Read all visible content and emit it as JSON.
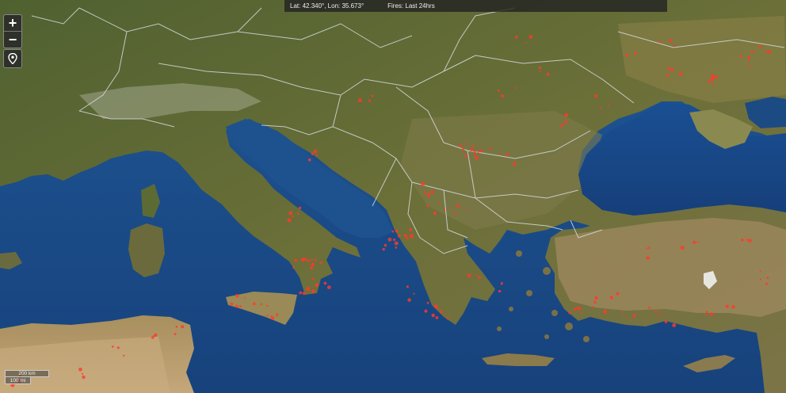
{
  "status": {
    "coords": "Lat: 42.340°, Lon: 35.673°",
    "fires": "Fires: Last 24hrs"
  },
  "controls": {
    "zoom_in": "+",
    "zoom_out": "−"
  },
  "scale": {
    "km": "200 km",
    "mi": "100 mi"
  },
  "colors": {
    "sea": "#1d4f8e",
    "land_green": "#5b6a31",
    "land_dry": "#a08a5c",
    "border": "#d8dde0",
    "fire": "#ff3a2a"
  }
}
